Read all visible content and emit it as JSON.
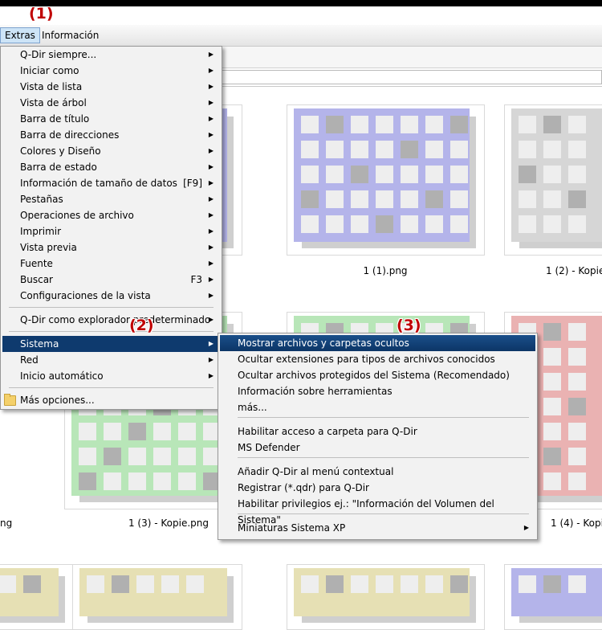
{
  "menubar": {
    "extras": "Extras",
    "info": "Información"
  },
  "annotations": {
    "a1": "(1)",
    "a2": "(2)",
    "a3": "(3)"
  },
  "menu": {
    "items": [
      {
        "label": "Q-Dir siempre...",
        "shortcut": "",
        "arrow": "▶"
      },
      {
        "label": "Iniciar como",
        "shortcut": "",
        "arrow": "▶"
      },
      {
        "label": "Vista de lista",
        "shortcut": "",
        "arrow": "▶"
      },
      {
        "label": "Vista de árbol",
        "shortcut": "",
        "arrow": "▶"
      },
      {
        "label": "Barra de título",
        "shortcut": "",
        "arrow": "▶"
      },
      {
        "label": "Barra de direcciones",
        "shortcut": "",
        "arrow": "▶"
      },
      {
        "label": "Colores y Diseño",
        "shortcut": "",
        "arrow": "▶"
      },
      {
        "label": "Barra de estado",
        "shortcut": "",
        "arrow": "▶"
      },
      {
        "label": "Información de tamaño de datos",
        "shortcut": "[F9]",
        "arrow": "▶"
      },
      {
        "label": "Pestañas",
        "shortcut": "",
        "arrow": "▶"
      },
      {
        "label": "Operaciones de archivo",
        "shortcut": "",
        "arrow": "▶"
      },
      {
        "label": "Imprimir",
        "shortcut": "",
        "arrow": "▶"
      },
      {
        "label": "Vista previa",
        "shortcut": "",
        "arrow": "▶"
      },
      {
        "label": "Fuente",
        "shortcut": "",
        "arrow": "▶"
      },
      {
        "label": "Buscar",
        "shortcut": "F3",
        "arrow": "▶"
      },
      {
        "label": "Configuraciones de la vista",
        "shortcut": "",
        "arrow": "▶"
      },
      {
        "label": "Q-Dir como explorador predeterminado",
        "shortcut": "",
        "arrow": "▶"
      },
      {
        "label": "Sistema",
        "shortcut": "",
        "arrow": "▶"
      },
      {
        "label": "Red",
        "shortcut": "",
        "arrow": "▶"
      },
      {
        "label": "Inicio automático",
        "shortcut": "",
        "arrow": "▶"
      },
      {
        "label": "Más opciones...",
        "shortcut": "",
        "arrow": ""
      }
    ]
  },
  "submenu": {
    "items": [
      {
        "label": "Mostrar archivos y carpetas ocultos",
        "arrow": ""
      },
      {
        "label": "Ocultar extensiones para tipos de archivos conocidos",
        "arrow": ""
      },
      {
        "label": "Ocultar archivos protegidos del Sistema (Recomendado)",
        "arrow": ""
      },
      {
        "label": "Información sobre herramientas",
        "arrow": ""
      },
      {
        "label": "más...",
        "arrow": ""
      },
      {
        "label": "Habilitar acceso a carpeta para Q-Dir",
        "arrow": ""
      },
      {
        "label": "MS Defender",
        "arrow": ""
      },
      {
        "label": "Añadir Q-Dir al menú contextual",
        "arrow": ""
      },
      {
        "label": "Registrar (*.qdr) para Q-Dir",
        "arrow": ""
      },
      {
        "label": "Habilitar privilegios ej.: \"Información del Volumen del Sistema\"",
        "arrow": ""
      },
      {
        "label": "Miniaturas Sistema XP",
        "arrow": "▶"
      }
    ]
  },
  "files": {
    "captions": [
      "1 (1).png",
      "1 (2) - Kopie",
      "1 (3) - Kopie.png",
      "1 (4) - Kopie",
      "ng"
    ]
  },
  "colors": {
    "blue_grid": "#b4b4ea",
    "gray_grid": "#d6d6d6",
    "green_grid": "#b8e6b8",
    "red_grid": "#eab2b2",
    "yellow_grid": "#e6e0b4",
    "highlight": "#0e3a6e"
  }
}
